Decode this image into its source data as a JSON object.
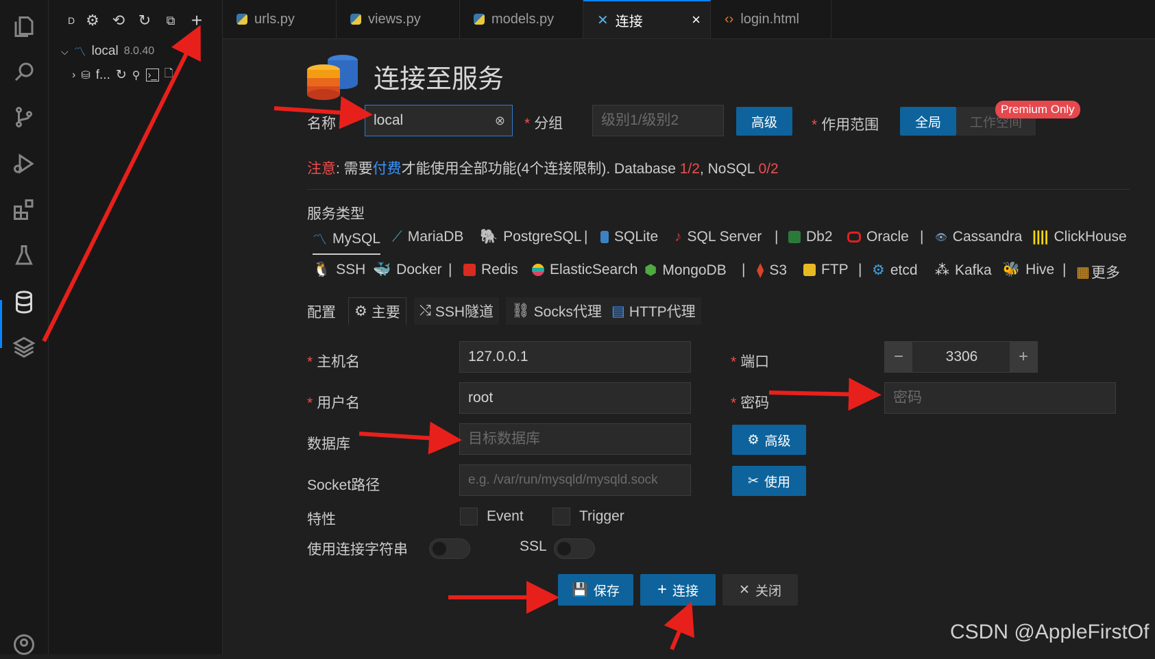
{
  "sidebar": {
    "header_letter": "D",
    "connection": {
      "name": "local",
      "version": "8.0.40"
    },
    "child": {
      "label": "f..."
    }
  },
  "tabs": [
    {
      "label": "urls.py",
      "active": false
    },
    {
      "label": "views.py",
      "active": false
    },
    {
      "label": "models.py",
      "active": false
    },
    {
      "label": "连接",
      "active": true
    },
    {
      "label": "login.html",
      "active": false
    }
  ],
  "page": {
    "title": "连接至服务",
    "name_label": "名称",
    "name_value": "local",
    "group_label": "分组",
    "group_placeholder": "级别1/级别2",
    "advanced_label": "高级",
    "scope_label": "作用范围",
    "scope_global": "全局",
    "scope_workspace": "工作空间",
    "premium_badge": "Premium Only"
  },
  "notice": {
    "prefix": "注意",
    "text1": ": 需要",
    "link": "付费",
    "text2": "才能使用全部功能(4个连接限制). Database ",
    "db_count": "1/2",
    "text3": ", NoSQL ",
    "nosql_count": "0/2"
  },
  "service_types": {
    "label": "服务类型",
    "row1": [
      "MySQL",
      "MariaDB",
      "PostgreSQL",
      "SQLite",
      "SQL Server",
      "Db2",
      "Oracle",
      "Cassandra",
      "ClickHouse"
    ],
    "row2": [
      "SSH",
      "Docker",
      "Redis",
      "ElasticSearch",
      "MongoDB",
      "S3",
      "FTP",
      "etcd",
      "Kafka",
      "Hive",
      "更多"
    ],
    "separator": "|"
  },
  "config": {
    "label": "配置",
    "tabs": [
      "主要",
      "SSH隧道",
      "Socks代理",
      "HTTP代理"
    ]
  },
  "fields": {
    "host_label": "主机名",
    "host_value": "127.0.0.1",
    "port_label": "端口",
    "port_value": "3306",
    "user_label": "用户名",
    "user_value": "root",
    "password_label": "密码",
    "password_placeholder": "密码",
    "database_label": "数据库",
    "database_placeholder": "目标数据库",
    "socket_label": "Socket路径",
    "socket_placeholder": "e.g. /var/run/mysqld/mysqld.sock",
    "advanced_btn": "高级",
    "use_btn": "使用",
    "features_label": "特性",
    "event_label": "Event",
    "trigger_label": "Trigger",
    "conn_string_label": "使用连接字符串",
    "ssl_label": "SSL"
  },
  "actions": {
    "save": "保存",
    "connect": "连接",
    "close": "关闭"
  },
  "stepper": {
    "minus": "−",
    "plus": "+"
  },
  "watermark": "CSDN @AppleFirstOf",
  "colors": {
    "accent": "#0e639c",
    "required": "#f14c4c",
    "link": "#3794ff",
    "premium": "#e5484d",
    "annotation_arrow": "#e8201b"
  }
}
